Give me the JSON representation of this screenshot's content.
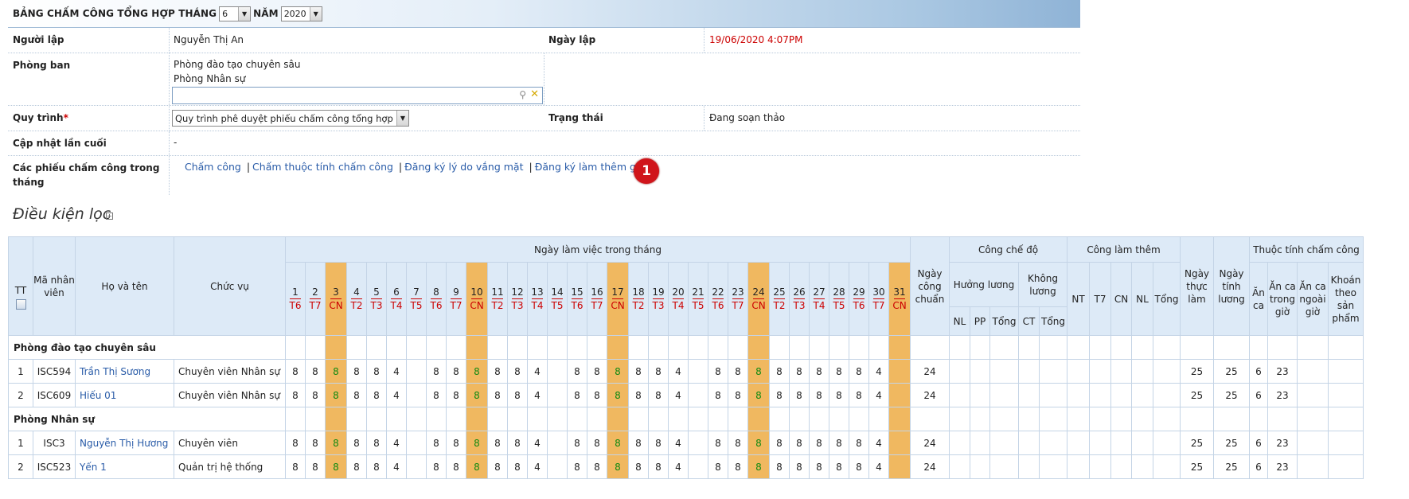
{
  "header": {
    "title": "BẢNG CHẤM CÔNG TỔNG HỢP THÁNG",
    "month": "6",
    "year_label": "NĂM",
    "year": "2020"
  },
  "info": {
    "creator_label": "Người lập",
    "creator": "Nguyễn Thị An",
    "date_label": "Ngày lập",
    "date": "19/06/2020 4:07PM",
    "dept_label": "Phòng ban",
    "departments": [
      "Phòng đào tạo chuyên sâu",
      "Phòng Nhân sự"
    ],
    "process_label": "Quy trình",
    "process_required": "*",
    "process_value": "Quy trình phê duyệt phiếu chấm công tổng hợp",
    "status_label": "Trạng thái",
    "status": "Đang soạn thảo",
    "updated_label": "Cập nhật lần cuối",
    "updated": "-",
    "forms_label": "Các phiếu chấm công trong tháng",
    "links": [
      "Chấm công",
      "Chấm thuộc tính chấm công",
      "Đăng ký lý do vắng mặt",
      "Đăng ký làm thêm giờ"
    ],
    "separator": "|",
    "badge": "1"
  },
  "filter": {
    "title": "Điều kiện lọc",
    "toggle": "+"
  },
  "grid": {
    "headers": {
      "tt": "TT",
      "code": "Mã nhân viên",
      "name": "Họ và tên",
      "position": "Chức vụ",
      "workdays": "Ngày làm việc trong tháng",
      "standard": "Ngày công chuẩn",
      "regime": "Công chế độ",
      "paid": "Hưởng lương",
      "unpaid": "Không lương",
      "overtime": "Công làm thêm",
      "actual": "Ngày thực làm",
      "salary_days": "Ngày tính lương",
      "attributes": "Thuộc tính chấm công",
      "paid_sub": [
        "NL",
        "PP",
        "Tổng"
      ],
      "unpaid_sub": [
        "CT",
        "Tổng"
      ],
      "ot_sub": [
        "NT",
        "T7",
        "CN",
        "NL",
        "Tổng"
      ],
      "attr_sub": [
        "Ăn ca",
        "Ăn ca trong giờ",
        "Ăn ca ngoài giờ",
        "Khoán theo sản phẩm"
      ]
    },
    "days": [
      [
        "1",
        "T6"
      ],
      [
        "2",
        "T7"
      ],
      [
        "3",
        "CN"
      ],
      [
        "4",
        "T2"
      ],
      [
        "5",
        "T3"
      ],
      [
        "6",
        "T4"
      ],
      [
        "7",
        "T5"
      ],
      [
        "8",
        "T6"
      ],
      [
        "9",
        "T7"
      ],
      [
        "10",
        "CN"
      ],
      [
        "11",
        "T2"
      ],
      [
        "12",
        "T3"
      ],
      [
        "13",
        "T4"
      ],
      [
        "14",
        "T5"
      ],
      [
        "15",
        "T6"
      ],
      [
        "16",
        "T7"
      ],
      [
        "17",
        "CN"
      ],
      [
        "18",
        "T2"
      ],
      [
        "19",
        "T3"
      ],
      [
        "20",
        "T4"
      ],
      [
        "21",
        "T5"
      ],
      [
        "22",
        "T6"
      ],
      [
        "23",
        "T7"
      ],
      [
        "24",
        "CN"
      ],
      [
        "25",
        "T2"
      ],
      [
        "26",
        "T3"
      ],
      [
        "27",
        "T4"
      ],
      [
        "28",
        "T5"
      ],
      [
        "29",
        "T6"
      ],
      [
        "30",
        "T7"
      ],
      [
        "31",
        "CN"
      ]
    ],
    "groups": [
      {
        "name": "Phòng đào tạo chuyên sâu",
        "rows": [
          {
            "tt": "1",
            "code": "ISC594",
            "name": "Trần Thị Sương",
            "position": "Chuyên viên Nhân sự",
            "days": [
              "8",
              "8",
              "8",
              "8",
              "8",
              "4",
              "",
              "8",
              "8",
              "8",
              "8",
              "8",
              "4",
              "",
              "8",
              "8",
              "8",
              "8",
              "8",
              "4",
              "",
              "8",
              "8",
              "8",
              "8",
              "8",
              "8",
              "8",
              "8",
              "4",
              ""
            ],
            "standard": "24",
            "actual": "25",
            "salary_days": "25",
            "an_ca": "6",
            "an_ca_trong_gio": "23"
          },
          {
            "tt": "2",
            "code": "ISC609",
            "name": "Hiếu 01",
            "position": "Chuyên viên Nhân sự",
            "days": [
              "8",
              "8",
              "8",
              "8",
              "8",
              "4",
              "",
              "8",
              "8",
              "8",
              "8",
              "8",
              "4",
              "",
              "8",
              "8",
              "8",
              "8",
              "8",
              "4",
              "",
              "8",
              "8",
              "8",
              "8",
              "8",
              "8",
              "8",
              "8",
              "4",
              ""
            ],
            "standard": "24",
            "actual": "25",
            "salary_days": "25",
            "an_ca": "6",
            "an_ca_trong_gio": "23"
          }
        ]
      },
      {
        "name": "Phòng Nhân sự",
        "rows": [
          {
            "tt": "1",
            "code": "ISC3",
            "name": "Nguyễn Thị Hương",
            "position": "Chuyên viên",
            "days": [
              "8",
              "8",
              "8",
              "8",
              "8",
              "4",
              "",
              "8",
              "8",
              "8",
              "8",
              "8",
              "4",
              "",
              "8",
              "8",
              "8",
              "8",
              "8",
              "4",
              "",
              "8",
              "8",
              "8",
              "8",
              "8",
              "8",
              "8",
              "8",
              "4",
              ""
            ],
            "standard": "24",
            "actual": "25",
            "salary_days": "25",
            "an_ca": "6",
            "an_ca_trong_gio": "23"
          },
          {
            "tt": "2",
            "code": "ISC523",
            "name": "Yến 1",
            "position": "Quản trị hệ thống",
            "days": [
              "8",
              "8",
              "8",
              "8",
              "8",
              "4",
              "",
              "8",
              "8",
              "8",
              "8",
              "8",
              "4",
              "",
              "8",
              "8",
              "8",
              "8",
              "8",
              "4",
              "",
              "8",
              "8",
              "8",
              "8",
              "8",
              "8",
              "8",
              "8",
              "4",
              ""
            ],
            "standard": "24",
            "actual": "25",
            "salary_days": "25",
            "an_ca": "6",
            "an_ca_trong_gio": "23"
          }
        ]
      }
    ]
  }
}
